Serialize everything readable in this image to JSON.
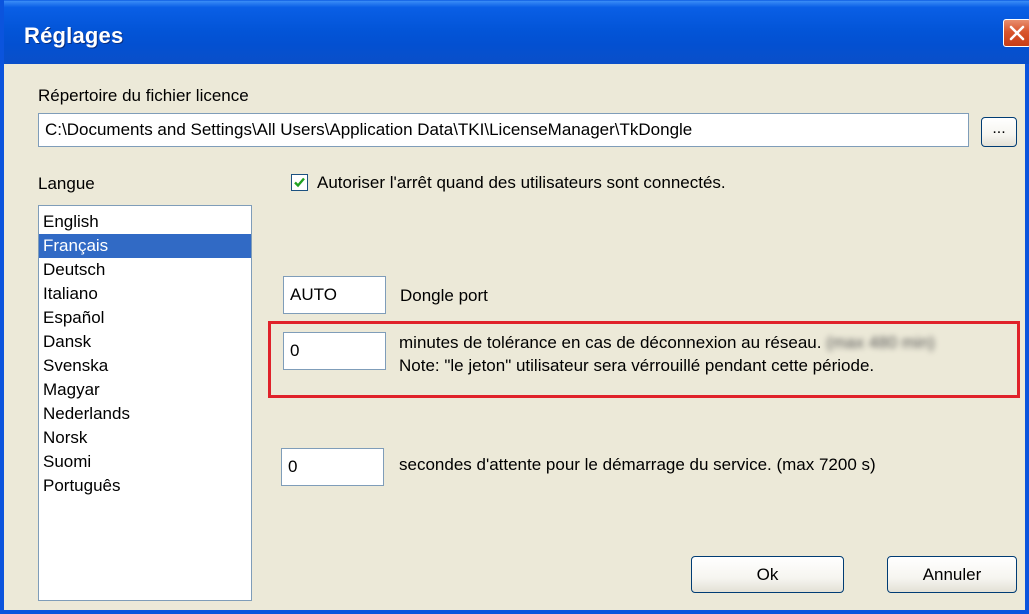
{
  "window": {
    "title": "Réglages"
  },
  "license": {
    "label": "Répertoire du fichier licence",
    "path": "C:\\Documents and Settings\\All Users\\Application Data\\TKI\\LicenseManager\\TkDongle",
    "browse_label": "..."
  },
  "language": {
    "label": "Langue",
    "items": [
      "English",
      "Français",
      "Deutsch",
      "Italiano",
      "Español",
      "Dansk",
      "Svenska",
      "Magyar",
      "Nederlands",
      "Norsk",
      "Suomi",
      "Português"
    ],
    "selected_index": 1
  },
  "allow_shutdown": {
    "checked": true,
    "label": "Autoriser l'arrêt quand des utilisateurs sont connectés."
  },
  "dongle": {
    "value": "AUTO",
    "label": "Dongle port"
  },
  "tolerance": {
    "value": "0",
    "label_line1": "minutes de tolérance en cas de déconnexion au réseau.",
    "blurred_text": "(max 480 min)",
    "label_line2": "Note: \"le jeton\" utilisateur sera vérrouillé pendant cette période."
  },
  "startup_wait": {
    "value": "0",
    "label": "secondes d'attente pour le démarrage du service. (max 7200 s)"
  },
  "buttons": {
    "ok": "Ok",
    "cancel": "Annuler"
  },
  "colors": {
    "titlebar": "#0355d8",
    "selection": "#316ac5",
    "highlight": "#e0222a",
    "dialog_bg": "#ece9d8"
  }
}
